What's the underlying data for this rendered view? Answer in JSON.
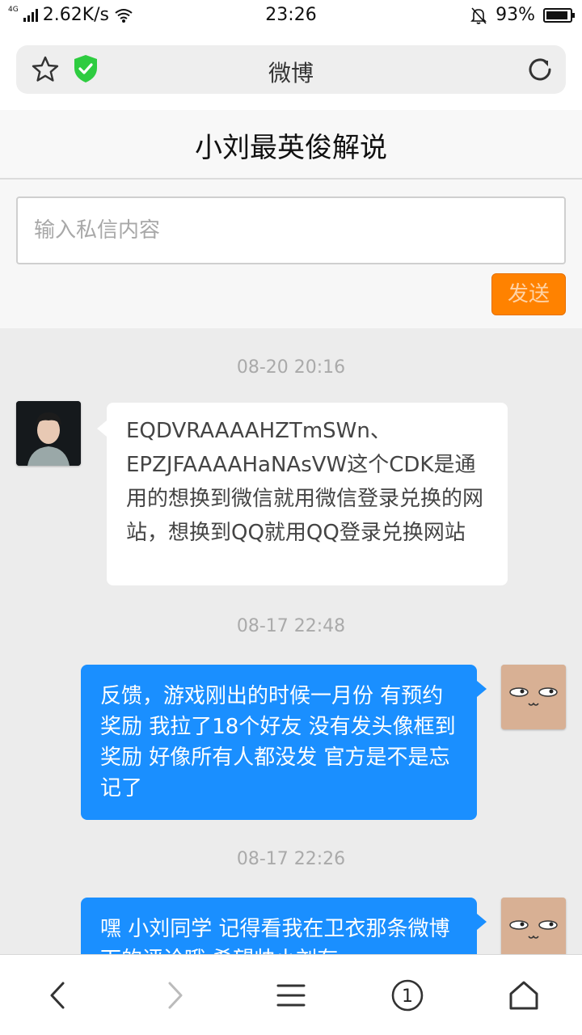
{
  "status_bar": {
    "network_type": "4G",
    "speed": "2.62K/s",
    "time": "23:26",
    "battery_percent": "93%",
    "battery_level": 0.93
  },
  "browser": {
    "title": "微博"
  },
  "header": {
    "title": "小刘最英俊解说"
  },
  "compose": {
    "placeholder": "输入私信内容",
    "send_label": "发送",
    "send_color": "#ff8200"
  },
  "messages": [
    {
      "timestamp": "08-20 20:16",
      "direction": "incoming",
      "text": "EQDVRAAAAHZTmSWn、EPZJFAAAAHaNAsVW这个CDK是通用的想换到微信就用微信登录兑换的网站，想换到QQ就用QQ登录兑换网站"
    },
    {
      "timestamp": "08-17 22:48",
      "direction": "outgoing",
      "text": "反馈，游戏刚出的时候一月份 有预约奖励 我拉了18个好友 没有发头像框到奖励 好像所有人都没发 官方是不是忘记了"
    },
    {
      "timestamp": "08-17 22:26",
      "direction": "outgoing",
      "text": "嘿 小刘同学 记得看我在卫衣那条微博下的评论哦 希望帅小刘有"
    }
  ],
  "nav": {
    "tab_count": "1"
  },
  "colors": {
    "outgoing_bubble": "#1a8fff",
    "incoming_bubble": "#ffffff",
    "shield": "#2ecc40"
  }
}
